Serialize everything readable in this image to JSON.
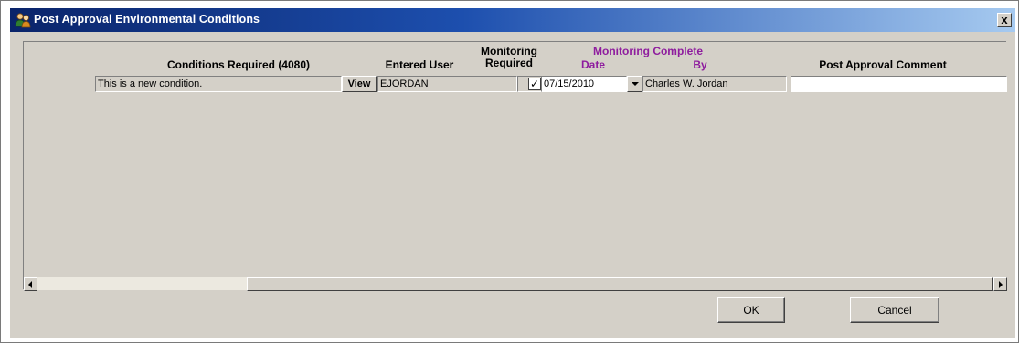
{
  "window": {
    "title": "Post Approval Environmental Conditions",
    "close_label": "x"
  },
  "grid": {
    "headers": {
      "conditions_required": "Conditions Required (4080)",
      "entered_user": "Entered User",
      "monitoring_required_line1": "Monitoring",
      "monitoring_required_line2": "Required",
      "monitoring_complete": "Monitoring Complete",
      "date": "Date",
      "by": "By",
      "post_approval_comment": "Post Approval Comment"
    },
    "rows": [
      {
        "condition": "This is a new condition.",
        "view_label": "View",
        "entered_user": "EJORDAN",
        "monitoring_required": true,
        "date": "07/15/2010",
        "by": "Charles W. Jordan",
        "comment": ""
      }
    ]
  },
  "buttons": {
    "ok": "OK",
    "cancel": "Cancel"
  },
  "colors": {
    "accent_header": "#8e1c9e",
    "titlebar": "#0a246a",
    "dialog_face": "#d4d0c8"
  }
}
